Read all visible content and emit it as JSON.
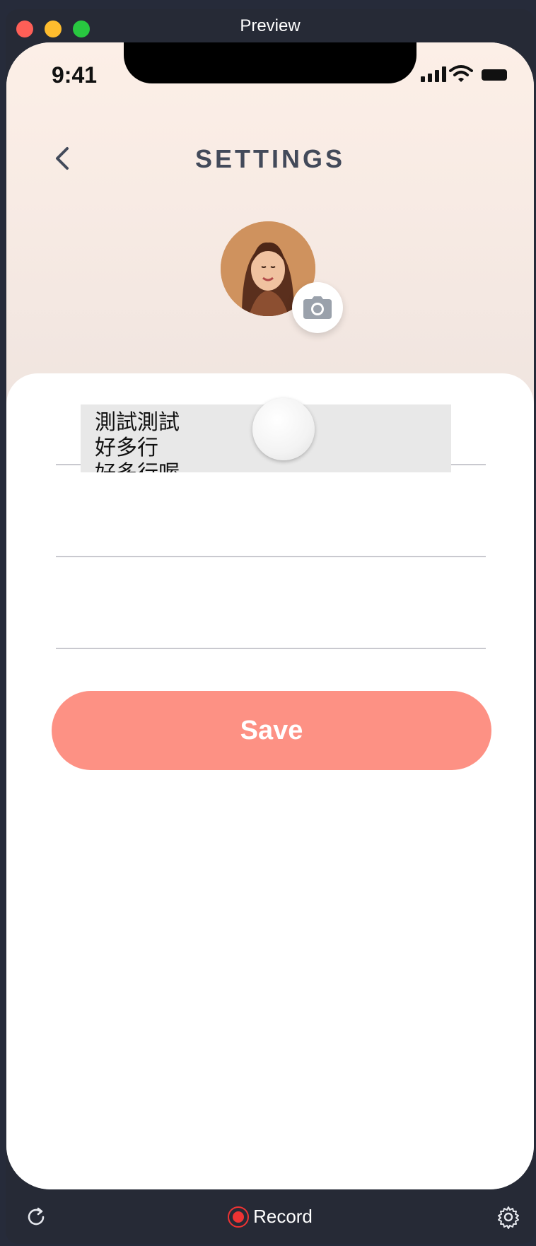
{
  "window": {
    "title": "Preview"
  },
  "status_bar": {
    "time": "9:41"
  },
  "header": {
    "title": "SETTINGS"
  },
  "avatar": {
    "alt": "profile photo"
  },
  "picker": {
    "lines": [
      "測試測試",
      "好多行",
      "好多行喔"
    ]
  },
  "form": {
    "save_label": "Save"
  },
  "toolbar": {
    "record_label": "Record"
  },
  "colors": {
    "accent": "#fd9184",
    "title": "#434a5a",
    "header_bg": "#fcefe7",
    "chrome": "#262a36"
  },
  "icons": [
    "back-chevron-icon",
    "camera-icon",
    "reload-icon",
    "record-icon",
    "gear-icon",
    "signal-icon",
    "wifi-icon",
    "battery-icon"
  ]
}
